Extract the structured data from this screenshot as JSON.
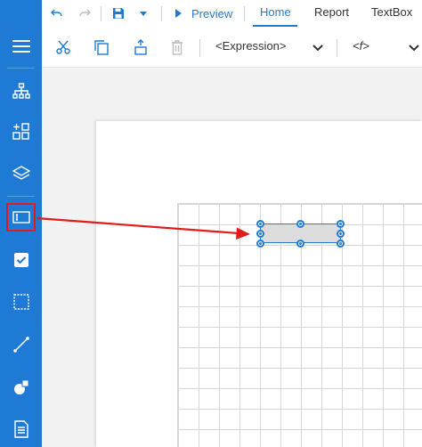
{
  "toolbar": {
    "preview_label": "Preview",
    "tabs": [
      {
        "label": "Home",
        "active": true
      },
      {
        "label": "Report",
        "active": false
      },
      {
        "label": "TextBox",
        "active": false
      }
    ],
    "expression_dropdown": "<Expression>",
    "function_dropdown": "<f>"
  },
  "colors": {
    "accent": "#1f7ad6",
    "highlight": "#e21b1b",
    "textbox_fill": "#dcdcdc"
  },
  "sidebar": {
    "items": [
      {
        "icon": "hamburger-menu-icon"
      },
      {
        "icon": "hierarchy-icon"
      },
      {
        "icon": "add-component-icon"
      },
      {
        "icon": "layers-icon"
      },
      {
        "icon": "textbox-tool-icon",
        "highlighted": true
      },
      {
        "icon": "checkbox-tool-icon"
      },
      {
        "icon": "rectangle-tool-icon"
      },
      {
        "icon": "line-tool-icon"
      },
      {
        "icon": "shape-tool-icon"
      },
      {
        "icon": "report-doc-icon"
      }
    ]
  }
}
